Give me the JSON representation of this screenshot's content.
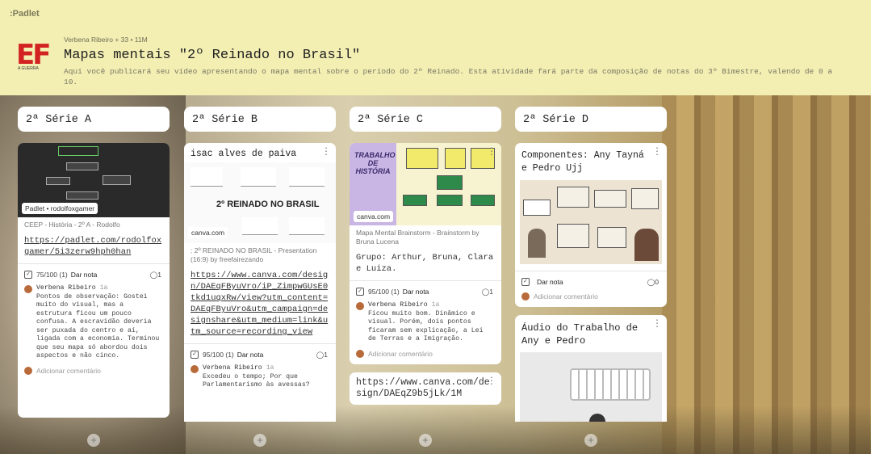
{
  "app": {
    "brand": "Padlet"
  },
  "board": {
    "meta": "Verbena Ribeiro + 33 • 11M",
    "title": "Mapas mentais \"2º Reinado no Brasil\"",
    "description": "Aqui você publicará seu vídeo apresentando o mapa mental sobre o período do 2º Reinado. Esta atividade fará parte da composição de notas do 3º Bimestre, valendo de 0 a 10.",
    "logo_text": "EF",
    "logo_sub": "A GUERRA"
  },
  "columns": [
    {
      "title": "2ª Série A",
      "cards": [
        {
          "thumb_tag": "Padlet • rodolfoxgamer",
          "source": "CEEP - História - 2º A - Rodolfo",
          "link": "https://padlet.com/rodolfoxgamer/5i3zerw9hph0han",
          "grade": "75/100 (1)",
          "grade_label": "Dar nota",
          "comment_count": "1",
          "comment_author": "Verbena Ribeiro",
          "comment_time": "1a",
          "comment_text": "Pontos de observação: Gostei muito do visual, mas a estrutura ficou um pouco confusa. A escravidão deveria ser puxada do centro e aí, ligada com a economia. Terminou que seu mapa só abordou dois aspectos e não cinco.",
          "add_comment": "Adicionar comentário"
        }
      ]
    },
    {
      "title": "2ª Série B",
      "cards": [
        {
          "card_title": "isac alves de paiva",
          "thumb_tag": "canva.com",
          "thumb_heading": "2º REINADO NO BRASIL",
          "source": ": 2º REINADO NO BRASIL - Presentation (16:9) by freefairezando",
          "link": "https://www.canva.com/design/DAEqFByuVro/iP_ZimpwGUsE0tkd1uqxRw/view?utm_content=DAEqFByuVro&utm_campaign=designshare&utm_medium=link&utm_source=recording_view",
          "grade": "95/100 (1)",
          "grade_label": "Dar nota",
          "comment_count": "1",
          "comment_author": "Verbena Ribeiro",
          "comment_time": "1a",
          "comment_text": "Excedeu o tempo; Por que Parlamentarismo às avessas?"
        }
      ]
    },
    {
      "title": "2ª Série C",
      "cards": [
        {
          "thumb_tag": "canva.com",
          "thumb_heading": "TRABALHO DE HISTÓRIA",
          "source": "Mapa Mental Brainstorm - Brainstorm by Bruna Lucena",
          "body": "Grupo: Arthur, Bruna, Clara e Luiza.",
          "grade": "95/100 (1)",
          "grade_label": "Dar nota",
          "comment_count": "1",
          "comment_author": "Verbena Ribeiro",
          "comment_time": "1a",
          "comment_text": "Ficou muito bom. Dinâmico e visual. Porém, dois pontos ficaram sem explicação, a Lei de Terras e a Imigração.",
          "add_comment": "Adicionar comentário"
        },
        {
          "link": "https://www.canva.com/design/DAEqZ9b5jLk/1M"
        }
      ]
    },
    {
      "title": "2ª Série D",
      "cards": [
        {
          "card_title": "Componentes: Any Tayná e Pedro Ujj",
          "grade_label": "Dar nota",
          "comment_count": "0",
          "add_comment": "Adicionar comentário"
        },
        {
          "card_title": "Áudio do Trabalho de Any e Pedro"
        }
      ]
    }
  ],
  "add_post_label": "+"
}
